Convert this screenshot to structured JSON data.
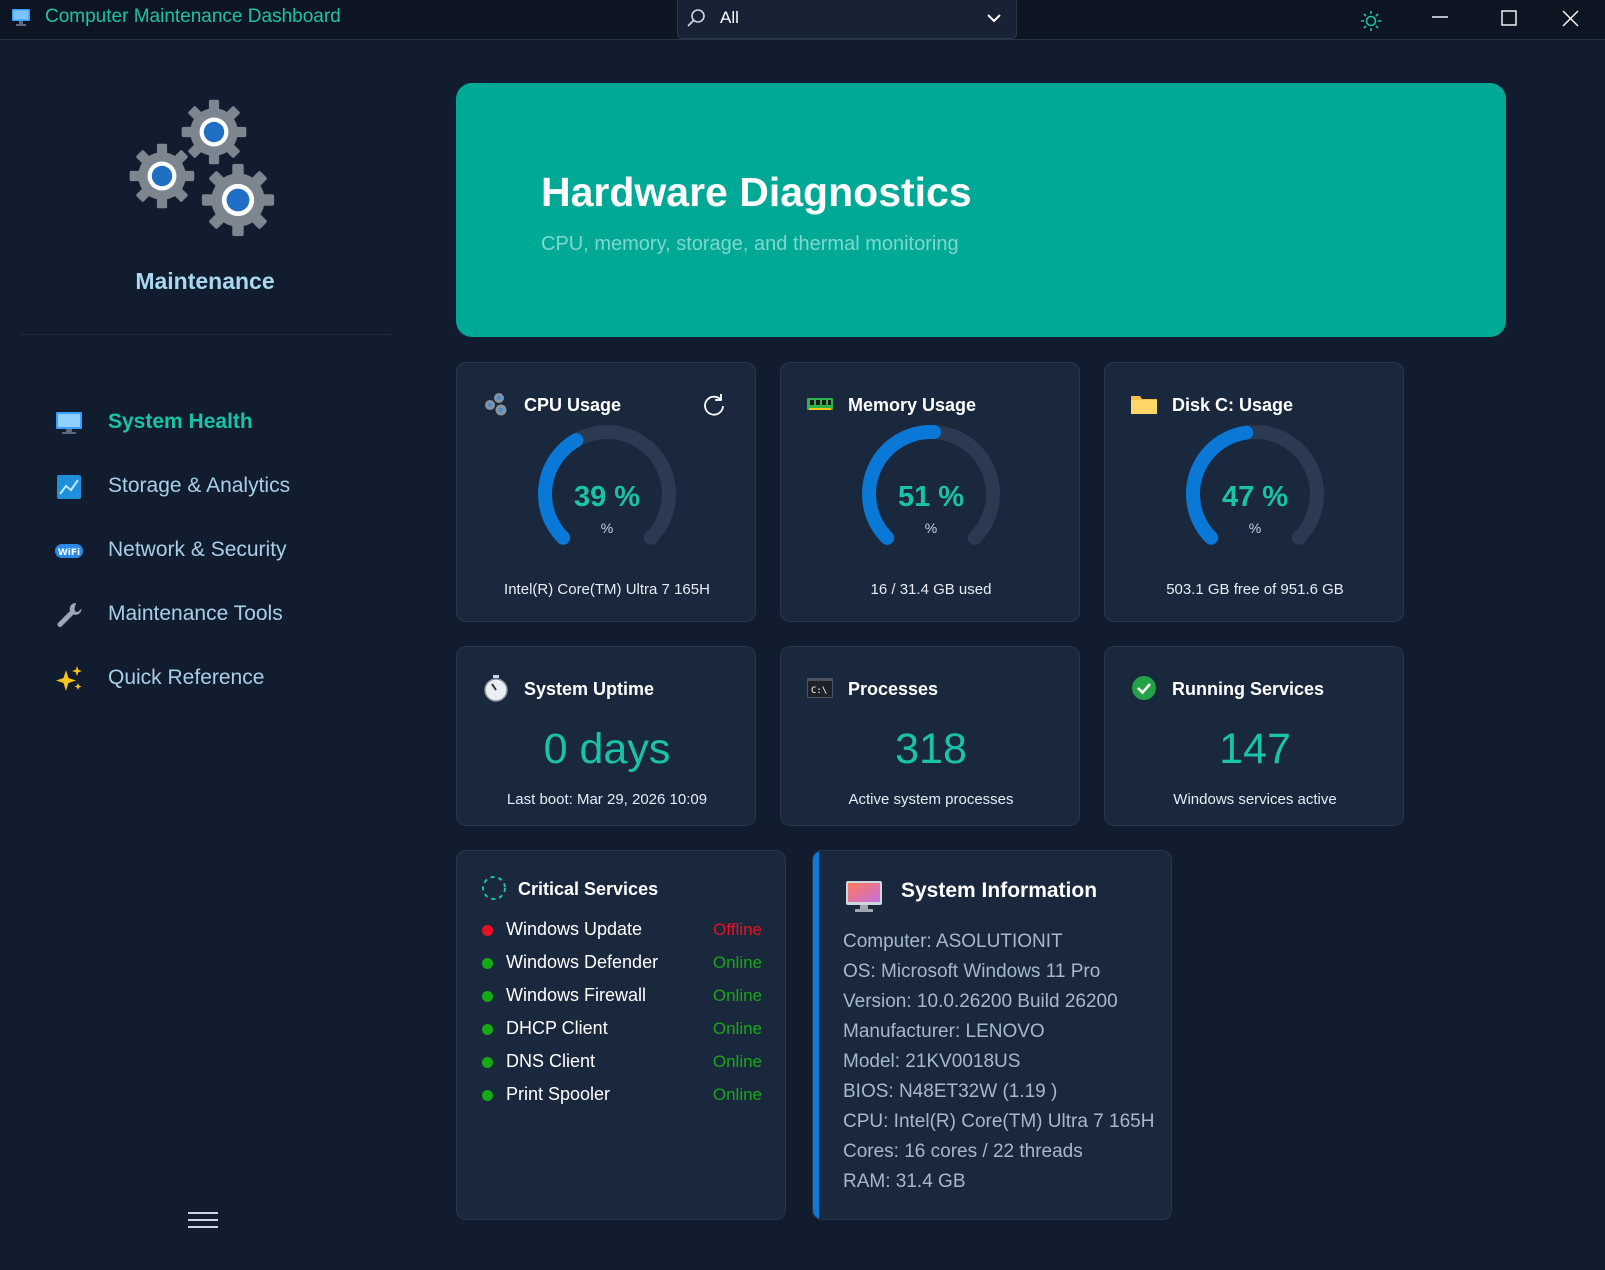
{
  "app": {
    "title": "Computer Maintenance Dashboard",
    "search_value": "All",
    "accent": "#19c3a6"
  },
  "sidebar": {
    "brand": "Maintenance",
    "items": [
      {
        "label": "System Health",
        "icon": "monitor-icon",
        "active": true
      },
      {
        "label": "Storage & Analytics",
        "icon": "chart-icon",
        "active": false
      },
      {
        "label": "Network & Security",
        "icon": "wifi-icon",
        "active": false
      },
      {
        "label": "Maintenance Tools",
        "icon": "wrench-icon",
        "active": false
      },
      {
        "label": "Quick Reference",
        "icon": "sparkles-icon",
        "active": false
      }
    ]
  },
  "banner": {
    "title": "Hardware Diagnostics",
    "subtitle": "CPU, memory, storage, and thermal monitoring",
    "color": "#00a896"
  },
  "gauges": [
    {
      "title": "CPU Usage",
      "value_text": "39 %",
      "value": 39,
      "unit": "%",
      "caption": "Intel(R) Core(TM) Ultra 7 165H"
    },
    {
      "title": "Memory Usage",
      "value_text": "51 %",
      "value": 51,
      "unit": "%",
      "caption": "16 / 31.4 GB used"
    },
    {
      "title": "Disk C: Usage",
      "value_text": "47 %",
      "value": 47,
      "unit": "%",
      "caption": "503.1 GB free of 951.6 GB"
    }
  ],
  "stats": [
    {
      "title": "System Uptime",
      "value": "0 days",
      "caption": "Last boot: Mar 29, 2026 10:09"
    },
    {
      "title": "Processes",
      "value": "318",
      "caption": "Active system processes"
    },
    {
      "title": "Running Services",
      "value": "147",
      "caption": "Windows services active"
    }
  ],
  "critical_services": {
    "title": "Critical Services",
    "items": [
      {
        "name": "Windows Update",
        "status": "Offline",
        "color": "#e81123"
      },
      {
        "name": "Windows Defender",
        "status": "Online",
        "color": "#16a816"
      },
      {
        "name": "Windows Firewall",
        "status": "Online",
        "color": "#16a816"
      },
      {
        "name": "DHCP Client",
        "status": "Online",
        "color": "#16a816"
      },
      {
        "name": "DNS Client",
        "status": "Online",
        "color": "#16a816"
      },
      {
        "name": "Print Spooler",
        "status": "Online",
        "color": "#16a816"
      }
    ]
  },
  "system_info": {
    "title": "System Information",
    "lines": [
      "Computer: ASOLUTIONIT",
      "OS: Microsoft Windows 11 Pro",
      "Version: 10.0.26200 Build 26200",
      "Manufacturer: LENOVO",
      "Model: 21KV0018US",
      "BIOS: N48ET32W (1.19 )",
      "CPU: Intel(R) Core(TM) Ultra 7 165H",
      "Cores: 16 cores / 22 threads",
      "RAM: 31.4 GB"
    ]
  }
}
